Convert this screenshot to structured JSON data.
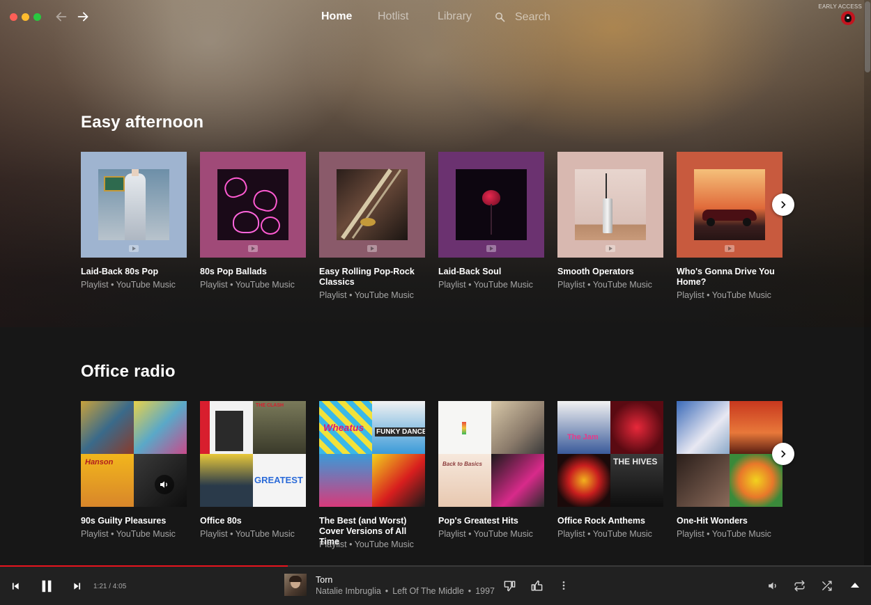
{
  "nav": {
    "home": "Home",
    "hotlist": "Hotlist",
    "library": "Library",
    "search_placeholder": "Search",
    "early_access": "EARLY ACCESS"
  },
  "sections": [
    {
      "title": "Easy afternoon",
      "cards": [
        {
          "title": "Laid-Back 80s Pop",
          "subtitle": "Playlist • YouTube Music"
        },
        {
          "title": "80s Pop Ballads",
          "subtitle": "Playlist • YouTube Music"
        },
        {
          "title": "Easy Rolling Pop-Rock Classics",
          "subtitle": "Playlist • YouTube Music"
        },
        {
          "title": "Laid-Back Soul",
          "subtitle": "Playlist • YouTube Music"
        },
        {
          "title": "Smooth Operators",
          "subtitle": "Playlist • YouTube Music"
        },
        {
          "title": "Who's Gonna Drive You Home?",
          "subtitle": "Playlist • YouTube Music"
        }
      ]
    },
    {
      "title": "Office radio",
      "cards": [
        {
          "title": "90s Guilty Pleasures",
          "subtitle": "Playlist • YouTube Music",
          "art_text": [
            "Hanson"
          ]
        },
        {
          "title": "Office 80s",
          "subtitle": "Playlist • YouTube Music",
          "art_text": [
            "THE CLASH",
            "GREATEST"
          ]
        },
        {
          "title": "The Best (and Worst) Cover Versions of All Time",
          "subtitle": "Playlist • YouTube Music",
          "art_text": [
            "Wheatus",
            "FUNKY DANCE"
          ]
        },
        {
          "title": "Pop's Greatest Hits",
          "subtitle": "Playlist • YouTube Music",
          "art_text": [
            "Back to Basics"
          ]
        },
        {
          "title": "Office Rock Anthems",
          "subtitle": "Playlist • YouTube Music",
          "art_text": [
            "The Jam",
            "THE HIVES"
          ]
        },
        {
          "title": "One-Hit Wonders",
          "subtitle": "Playlist • YouTube Music"
        }
      ]
    }
  ],
  "player": {
    "time": "1:21 / 4:05",
    "progress": 0.33,
    "track_title": "Torn",
    "artist": "Natalie Imbruglia",
    "album": "Left Of The Middle",
    "year": "1997",
    "separator": "•"
  },
  "colors": {
    "accent": "#e8141e",
    "player_bg": "#212121",
    "page_bg": "#171717"
  },
  "icons": {
    "back": "arrow-left-icon",
    "forward": "arrow-right-icon",
    "search": "search-icon",
    "next_carousel": "chevron-right-icon",
    "prev_track": "skip-previous-icon",
    "pause": "pause-icon",
    "next_track": "skip-next-icon",
    "dislike": "thumb-down-icon",
    "like": "thumb-up-icon",
    "more": "more-vertical-icon",
    "volume": "volume-icon",
    "repeat": "repeat-icon",
    "shuffle": "shuffle-icon",
    "expand": "expand-up-icon"
  }
}
